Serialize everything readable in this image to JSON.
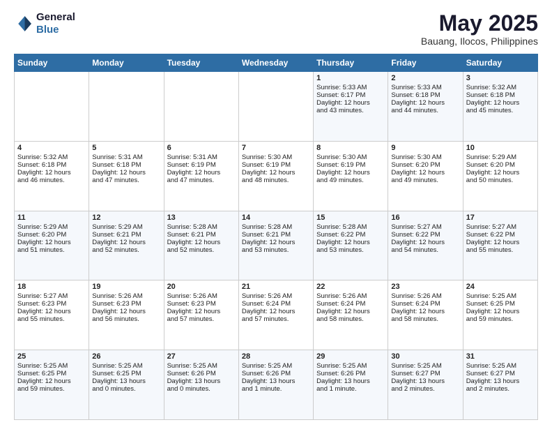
{
  "logo": {
    "line1": "General",
    "line2": "Blue"
  },
  "header": {
    "month": "May 2025",
    "location": "Bauang, Ilocos, Philippines"
  },
  "days": [
    "Sunday",
    "Monday",
    "Tuesday",
    "Wednesday",
    "Thursday",
    "Friday",
    "Saturday"
  ],
  "weeks": [
    [
      {
        "day": "",
        "content": ""
      },
      {
        "day": "",
        "content": ""
      },
      {
        "day": "",
        "content": ""
      },
      {
        "day": "",
        "content": ""
      },
      {
        "day": "1",
        "content": "Sunrise: 5:33 AM\nSunset: 6:17 PM\nDaylight: 12 hours\nand 43 minutes."
      },
      {
        "day": "2",
        "content": "Sunrise: 5:33 AM\nSunset: 6:18 PM\nDaylight: 12 hours\nand 44 minutes."
      },
      {
        "day": "3",
        "content": "Sunrise: 5:32 AM\nSunset: 6:18 PM\nDaylight: 12 hours\nand 45 minutes."
      }
    ],
    [
      {
        "day": "4",
        "content": "Sunrise: 5:32 AM\nSunset: 6:18 PM\nDaylight: 12 hours\nand 46 minutes."
      },
      {
        "day": "5",
        "content": "Sunrise: 5:31 AM\nSunset: 6:18 PM\nDaylight: 12 hours\nand 47 minutes."
      },
      {
        "day": "6",
        "content": "Sunrise: 5:31 AM\nSunset: 6:19 PM\nDaylight: 12 hours\nand 47 minutes."
      },
      {
        "day": "7",
        "content": "Sunrise: 5:30 AM\nSunset: 6:19 PM\nDaylight: 12 hours\nand 48 minutes."
      },
      {
        "day": "8",
        "content": "Sunrise: 5:30 AM\nSunset: 6:19 PM\nDaylight: 12 hours\nand 49 minutes."
      },
      {
        "day": "9",
        "content": "Sunrise: 5:30 AM\nSunset: 6:20 PM\nDaylight: 12 hours\nand 49 minutes."
      },
      {
        "day": "10",
        "content": "Sunrise: 5:29 AM\nSunset: 6:20 PM\nDaylight: 12 hours\nand 50 minutes."
      }
    ],
    [
      {
        "day": "11",
        "content": "Sunrise: 5:29 AM\nSunset: 6:20 PM\nDaylight: 12 hours\nand 51 minutes."
      },
      {
        "day": "12",
        "content": "Sunrise: 5:29 AM\nSunset: 6:21 PM\nDaylight: 12 hours\nand 52 minutes."
      },
      {
        "day": "13",
        "content": "Sunrise: 5:28 AM\nSunset: 6:21 PM\nDaylight: 12 hours\nand 52 minutes."
      },
      {
        "day": "14",
        "content": "Sunrise: 5:28 AM\nSunset: 6:21 PM\nDaylight: 12 hours\nand 53 minutes."
      },
      {
        "day": "15",
        "content": "Sunrise: 5:28 AM\nSunset: 6:22 PM\nDaylight: 12 hours\nand 53 minutes."
      },
      {
        "day": "16",
        "content": "Sunrise: 5:27 AM\nSunset: 6:22 PM\nDaylight: 12 hours\nand 54 minutes."
      },
      {
        "day": "17",
        "content": "Sunrise: 5:27 AM\nSunset: 6:22 PM\nDaylight: 12 hours\nand 55 minutes."
      }
    ],
    [
      {
        "day": "18",
        "content": "Sunrise: 5:27 AM\nSunset: 6:23 PM\nDaylight: 12 hours\nand 55 minutes."
      },
      {
        "day": "19",
        "content": "Sunrise: 5:26 AM\nSunset: 6:23 PM\nDaylight: 12 hours\nand 56 minutes."
      },
      {
        "day": "20",
        "content": "Sunrise: 5:26 AM\nSunset: 6:23 PM\nDaylight: 12 hours\nand 57 minutes."
      },
      {
        "day": "21",
        "content": "Sunrise: 5:26 AM\nSunset: 6:24 PM\nDaylight: 12 hours\nand 57 minutes."
      },
      {
        "day": "22",
        "content": "Sunrise: 5:26 AM\nSunset: 6:24 PM\nDaylight: 12 hours\nand 58 minutes."
      },
      {
        "day": "23",
        "content": "Sunrise: 5:26 AM\nSunset: 6:24 PM\nDaylight: 12 hours\nand 58 minutes."
      },
      {
        "day": "24",
        "content": "Sunrise: 5:25 AM\nSunset: 6:25 PM\nDaylight: 12 hours\nand 59 minutes."
      }
    ],
    [
      {
        "day": "25",
        "content": "Sunrise: 5:25 AM\nSunset: 6:25 PM\nDaylight: 12 hours\nand 59 minutes."
      },
      {
        "day": "26",
        "content": "Sunrise: 5:25 AM\nSunset: 6:25 PM\nDaylight: 13 hours\nand 0 minutes."
      },
      {
        "day": "27",
        "content": "Sunrise: 5:25 AM\nSunset: 6:26 PM\nDaylight: 13 hours\nand 0 minutes."
      },
      {
        "day": "28",
        "content": "Sunrise: 5:25 AM\nSunset: 6:26 PM\nDaylight: 13 hours\nand 1 minute."
      },
      {
        "day": "29",
        "content": "Sunrise: 5:25 AM\nSunset: 6:26 PM\nDaylight: 13 hours\nand 1 minute."
      },
      {
        "day": "30",
        "content": "Sunrise: 5:25 AM\nSunset: 6:27 PM\nDaylight: 13 hours\nand 2 minutes."
      },
      {
        "day": "31",
        "content": "Sunrise: 5:25 AM\nSunset: 6:27 PM\nDaylight: 13 hours\nand 2 minutes."
      }
    ]
  ]
}
